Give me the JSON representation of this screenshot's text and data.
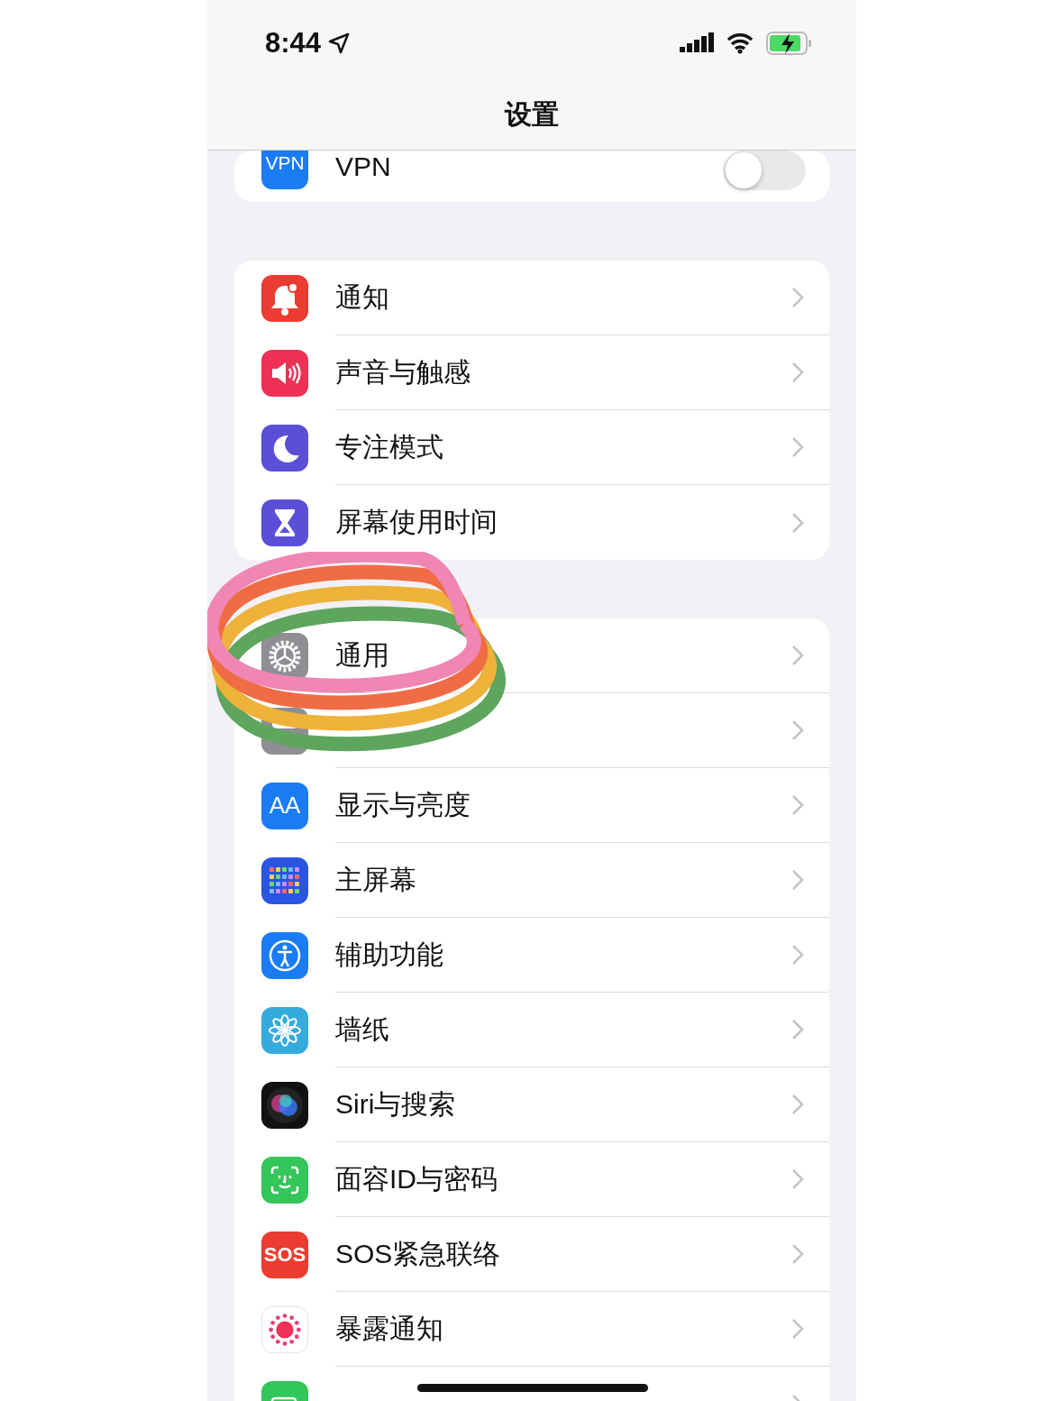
{
  "status_bar": {
    "time": "8:44"
  },
  "nav": {
    "title": "设置"
  },
  "groups": [
    {
      "rows": [
        {
          "kind": "toggle",
          "icon_text": "VPN",
          "label": "VPN",
          "on": false
        }
      ]
    },
    {
      "rows": [
        {
          "kind": "link",
          "label": "通知"
        },
        {
          "kind": "link",
          "label": "声音与触感"
        },
        {
          "kind": "link",
          "label": "专注模式"
        },
        {
          "kind": "link",
          "label": "屏幕使用时间"
        }
      ]
    },
    {
      "rows": [
        {
          "kind": "link",
          "label": "通用"
        },
        {
          "kind": "link"
        },
        {
          "kind": "link",
          "icon_text": "AA",
          "label": "显示与亮度"
        },
        {
          "kind": "link",
          "label": "主屏幕"
        },
        {
          "kind": "link",
          "label": "辅助功能"
        },
        {
          "kind": "link",
          "label": "墙纸"
        },
        {
          "kind": "link",
          "label": "Siri与搜索"
        },
        {
          "kind": "link",
          "label": "面容ID与密码"
        },
        {
          "kind": "link",
          "icon_text": "SOS",
          "label": "SOS紧急联络"
        },
        {
          "kind": "link",
          "label": "暴露通知"
        },
        {
          "kind": "link"
        }
      ]
    }
  ]
}
